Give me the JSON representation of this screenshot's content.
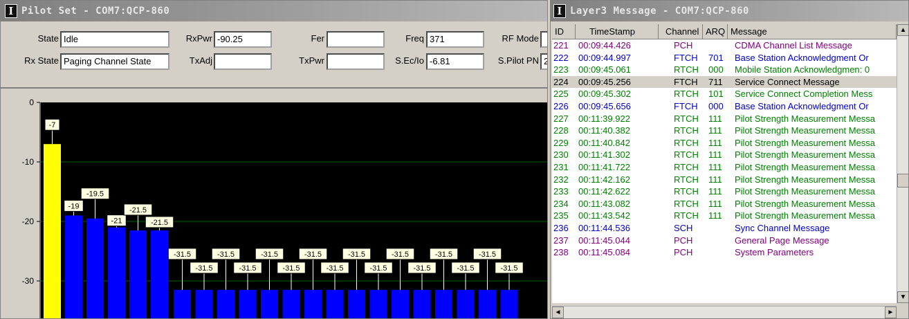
{
  "pilot": {
    "title": "Pilot Set - COM7:QCP-860",
    "fields": {
      "state_label": "State",
      "state_value": "Idle",
      "rxpwr_label": "RxPwr",
      "rxpwr_value": "-90.25",
      "fer_label": "Fer",
      "fer_value": "",
      "freq_label": "Freq",
      "freq_value": "371",
      "rfmode_label": "RF Mode",
      "rfmode_value": "",
      "rxstate_label": "Rx State",
      "rxstate_value": "Paging Channel State",
      "txadj_label": "TxAdj",
      "txadj_value": "",
      "txpwr_label": "TxPwr",
      "txpwr_value": "",
      "secio_label": "S.Ec/Io",
      "secio_value": "-6.81",
      "spilotpn_label": "S.Pilot PN",
      "spilotpn_value": "2"
    }
  },
  "chart_data": {
    "type": "bar",
    "ylim": [
      0,
      -35
    ],
    "yticks": [
      "0",
      "-10",
      "-20",
      "-30"
    ],
    "yticks_values": [
      0,
      -10,
      -20,
      -30
    ],
    "values": [
      -7,
      -19,
      -19.5,
      -21,
      -21.5,
      -21.5,
      -31.5,
      -31.5,
      -31.5,
      -31.5,
      -31.5,
      -31.5,
      -31.5,
      -31.5,
      -31.5,
      -31.5,
      -31.5,
      -31.5,
      -31.5,
      -31.5,
      -31.5,
      -31.5
    ],
    "labels": [
      "-7",
      "-19",
      "-19.5",
      "-21",
      "-21.5",
      "-21.5",
      "-31.5",
      "-31.5",
      "-31.5",
      "-31.5",
      "-31.5",
      "-31.5",
      "-31.5",
      "-31.5",
      "-31.5",
      "-31.5",
      "-31.5",
      "-31.5",
      "-31.5",
      "-31.5",
      "-31.5",
      "-31.5"
    ],
    "colors": {
      "active": "#ffff00",
      "other": "#0000ff",
      "background": "#000000",
      "grid": "#006400"
    }
  },
  "layer3": {
    "title": "Layer3 Message - COM7:QCP-860",
    "columns": {
      "id": "ID",
      "timestamp": "TimeStamp",
      "channel": "Channel",
      "arq": "ARQ",
      "message": "Message"
    },
    "rows": [
      {
        "id": "221",
        "time": "00:09:44.426",
        "channel": "PCH",
        "arq": "",
        "message": "CDMA Channel List Message",
        "color": "#800080"
      },
      {
        "id": "222",
        "time": "00:09:44.997",
        "channel": "FTCH",
        "arq": "701",
        "message": "Base Station Acknowledgment Or",
        "color": "#0000cc"
      },
      {
        "id": "223",
        "time": "00:09:45.061",
        "channel": "RTCH",
        "arq": "000",
        "message": "Mobile Station Acknowledgmen: 0",
        "color": "#008000"
      },
      {
        "id": "224",
        "time": "00:09:45.256",
        "channel": "FTCH",
        "arq": "711",
        "message": "Service Connect Message",
        "color": "#000000"
      },
      {
        "id": "225",
        "time": "00:09:45.302",
        "channel": "RTCH",
        "arq": "101",
        "message": "Service Connect Completion Mess",
        "color": "#008000"
      },
      {
        "id": "226",
        "time": "00:09:45.656",
        "channel": "FTCH",
        "arq": "000",
        "message": "Base Station Acknowledgment Or",
        "color": "#0000cc"
      },
      {
        "id": "227",
        "time": "00:11:39.922",
        "channel": "RTCH",
        "arq": "111",
        "message": "Pilot Strength Measurement Messa",
        "color": "#008000"
      },
      {
        "id": "228",
        "time": "00:11:40.382",
        "channel": "RTCH",
        "arq": "111",
        "message": "Pilot Strength Measurement Messa",
        "color": "#008000"
      },
      {
        "id": "229",
        "time": "00:11:40.842",
        "channel": "RTCH",
        "arq": "111",
        "message": "Pilot Strength Measurement Messa",
        "color": "#008000"
      },
      {
        "id": "230",
        "time": "00:11:41.302",
        "channel": "RTCH",
        "arq": "111",
        "message": "Pilot Strength Measurement Messa",
        "color": "#008000"
      },
      {
        "id": "231",
        "time": "00:11:41.722",
        "channel": "RTCH",
        "arq": "111",
        "message": "Pilot Strength Measurement Messa",
        "color": "#008000"
      },
      {
        "id": "232",
        "time": "00:11:42.162",
        "channel": "RTCH",
        "arq": "111",
        "message": "Pilot Strength Measurement Messa",
        "color": "#008000"
      },
      {
        "id": "233",
        "time": "00:11:42.622",
        "channel": "RTCH",
        "arq": "111",
        "message": "Pilot Strength Measurement Messa",
        "color": "#008000"
      },
      {
        "id": "234",
        "time": "00:11:43.082",
        "channel": "RTCH",
        "arq": "111",
        "message": "Pilot Strength Measurement Messa",
        "color": "#008000"
      },
      {
        "id": "235",
        "time": "00:11:43.542",
        "channel": "RTCH",
        "arq": "111",
        "message": "Pilot Strength Measurement Messa",
        "color": "#008000"
      },
      {
        "id": "236",
        "time": "00:11:44.536",
        "channel": "SCH",
        "arq": "",
        "message": "Sync Channel Message",
        "color": "#0000cc"
      },
      {
        "id": "237",
        "time": "00:11:45.044",
        "channel": "PCH",
        "arq": "",
        "message": "General Page Message",
        "color": "#800080"
      },
      {
        "id": "238",
        "time": "00:11:45.084",
        "channel": "PCH",
        "arq": "",
        "message": "System Parameters",
        "color": "#800080"
      }
    ]
  },
  "icons": {
    "app": "I",
    "up": "▲",
    "down": "▼",
    "left": "◄",
    "right": "►"
  }
}
